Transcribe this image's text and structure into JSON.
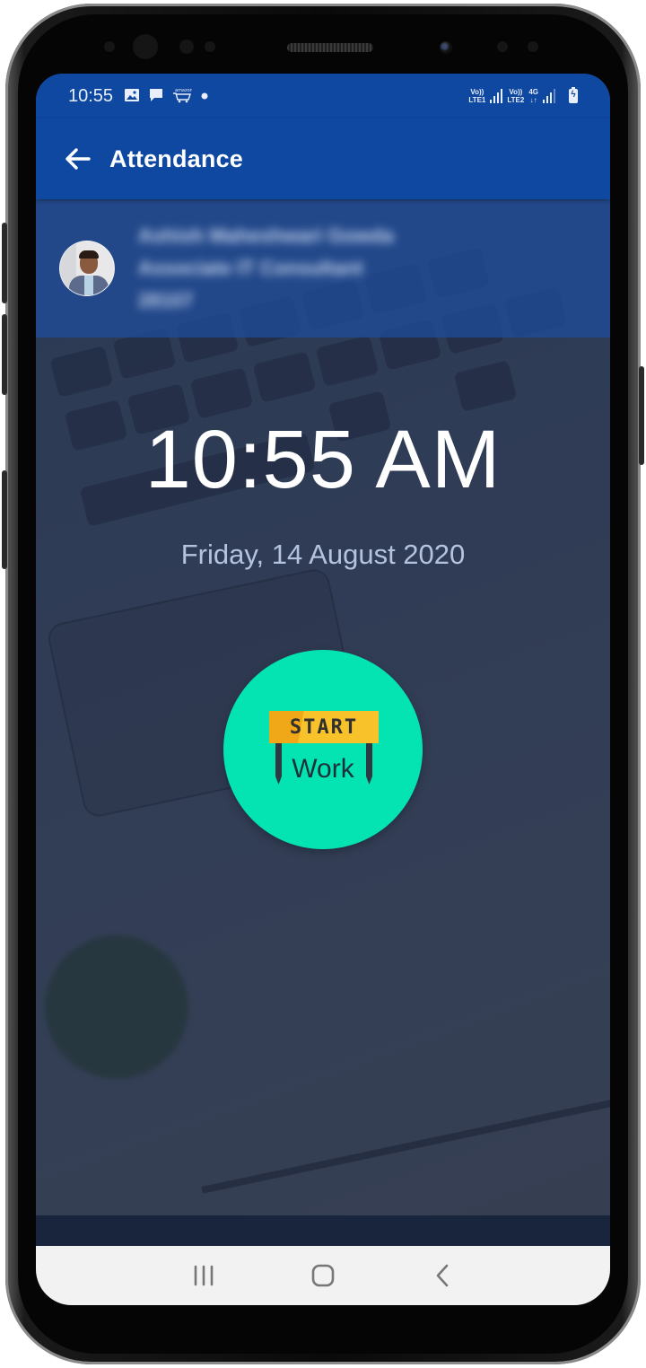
{
  "status_bar": {
    "time": "10:55",
    "left_icons": [
      "gallery-icon",
      "message-icon",
      "amazon-cart-icon",
      "dot-icon"
    ],
    "amazon_label": "amazon",
    "sim1": {
      "line1": "Vo))",
      "line2": "LTE1"
    },
    "sim2": {
      "line1": "Vo))",
      "line2": "LTE2"
    },
    "network_type": "4G",
    "battery_state": "charging"
  },
  "app_bar": {
    "title": "Attendance",
    "back_icon": "arrow-left-icon"
  },
  "profile": {
    "name": "Ashish Maheshwari Gowda",
    "designation": "Associate IT Consultant",
    "employee_id": "28107",
    "blurred": true
  },
  "clock": {
    "time": "10:55 AM",
    "date": "Friday, 14 August 2020"
  },
  "start_button": {
    "banner_label": "START",
    "label": "Work",
    "accent_color": "#04e4b2",
    "banner_color": "#f8c22a"
  },
  "nav_bar": {
    "recents_icon": "recent-apps-icon",
    "home_icon": "home-icon",
    "back_icon": "back-chevron-icon"
  },
  "colors": {
    "primary": "#0e48a0",
    "background": "#2e3a52",
    "date_text": "#b4c4e0"
  }
}
